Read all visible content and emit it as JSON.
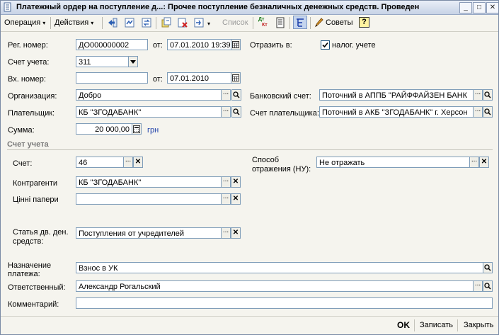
{
  "window": {
    "title": "Платежный ордер на поступление д...: Прочее поступление безналичных денежных средств. Проведен",
    "minimize_glyph": "_",
    "maximize_glyph": "□",
    "close_glyph": "✕"
  },
  "toolbar": {
    "operation_label": "Операция",
    "actions_label": "Действия",
    "list_label": "Список",
    "advice_label": "Советы",
    "help_glyph": "?",
    "dtkt_top": "Дт",
    "dtkt_bottom": "Кт",
    "dropdown_glyph": "▾"
  },
  "form": {
    "reg_number_label": "Рег. номер:",
    "reg_number_value": "ДО000000002",
    "from_label": "от:",
    "reg_date_value": "07.01.2010 19:39",
    "reflect_in_label": "Отразить в:",
    "tax_accounting_label": "налог. учете",
    "tax_accounting_checked": true,
    "account_label": "Счет учета:",
    "account_value": "311",
    "incoming_number_label": "Вх. номер:",
    "incoming_number_value": "",
    "incoming_from_label": "от:",
    "incoming_date_value": "07.01.2010",
    "organization_label": "Организация:",
    "organization_value": "Добро",
    "bank_account_label": "Банковский счет:",
    "bank_account_value": "Поточний в АППБ \"РАЙФФАЙЗЕН БАНК",
    "payer_label": "Плательщик:",
    "payer_value": "КБ \"ЗГОДАБАНК\"",
    "payer_account_label": "Счет плательщика:",
    "payer_account_value": "Поточний в АКБ \"ЗГОДАБАНК\" г. Херсон",
    "amount_label": "Сумма:",
    "amount_value": "20 000,00",
    "currency_label": "грн"
  },
  "section": {
    "title": "Счет учета",
    "account_label": "Счет:",
    "account_value": "46",
    "counterparties_label": "Контрагенти",
    "counterparties_value": "КБ \"ЗГОДАБАНК\"",
    "securities_label": "Цінні папери",
    "securities_value": "",
    "cashflow_label_line1": "Статья дв. ден.",
    "cashflow_label_line2": "средств:",
    "cashflow_value": "Поступления от учредителей",
    "reflection_method_label_line1": "Способ",
    "reflection_method_label_line2": "отражения (НУ):",
    "reflection_method_value": "Не отражать"
  },
  "bottom_form": {
    "purpose_label_line1": "Назначение",
    "purpose_label_line2": "платежа:",
    "purpose_value": "Взнос в УК",
    "responsible_label": "Ответственный:",
    "responsible_value": "Александр Рогальский",
    "comment_label": "Комментарий:",
    "comment_value": ""
  },
  "buttons": {
    "ok_label": "OK",
    "save_label": "Записать",
    "close_label": "Закрыть"
  },
  "colors": {
    "currency_link": "#1a3ca8",
    "section_title": "#7b7b7b"
  }
}
